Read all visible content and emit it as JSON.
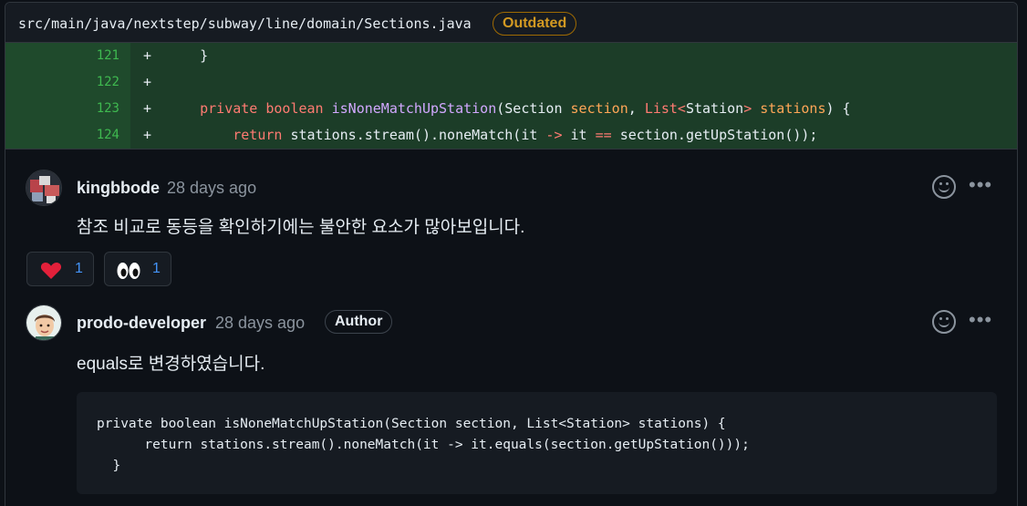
{
  "file": {
    "path": "src/main/java/nextstep/subway/line/domain/Sections.java",
    "badge": "Outdated"
  },
  "diff": {
    "lines": [
      {
        "num": "121",
        "sign": "+"
      },
      {
        "num": "122",
        "sign": "+"
      },
      {
        "num": "123",
        "sign": "+"
      },
      {
        "num": "124",
        "sign": "+"
      }
    ],
    "code": {
      "l121_brace": "}",
      "l123_private": "private",
      "l123_boolean": "boolean",
      "l123_fn": "isNoneMatchUpStation",
      "l123_a": "(Section ",
      "l123_section": "section",
      "l123_b": ", ",
      "l123_list": "List<",
      "l123_station": "Station",
      "l123_gt": ">",
      "l123_c": " ",
      "l123_stations": "stations",
      "l123_d": ") {",
      "l124_return": "return",
      "l124_a": " stations.stream().noneMatch(it ",
      "l124_arrow": "->",
      "l124_b": " it ",
      "l124_eq": "==",
      "l124_c": " section.getUpStation());"
    }
  },
  "comments": [
    {
      "author": "kingbbode",
      "time": "28 days ago",
      "body": "참조 비교로 동등을 확인하기에는 불안한 요소가 많아보입니다.",
      "reactions": [
        {
          "emoji": "heart",
          "count": "1"
        },
        {
          "emoji": "eyes",
          "count": "1"
        }
      ]
    },
    {
      "author": "prodo-developer",
      "time": "28 days ago",
      "badge": "Author",
      "body": "equals로 변경하였습니다.",
      "code": "private boolean isNoneMatchUpStation(Section section, List<Station> stations) {\n      return stations.stream().noneMatch(it -> it.equals(section.getUpStation()));\n  }"
    }
  ],
  "colors": {
    "diff_add_bg": "#1c3d28",
    "keyword": "#ff7b72",
    "function": "#d2a8ff",
    "param": "#ffa657",
    "link_blue": "#4493f8",
    "outdated": "#d29922"
  }
}
